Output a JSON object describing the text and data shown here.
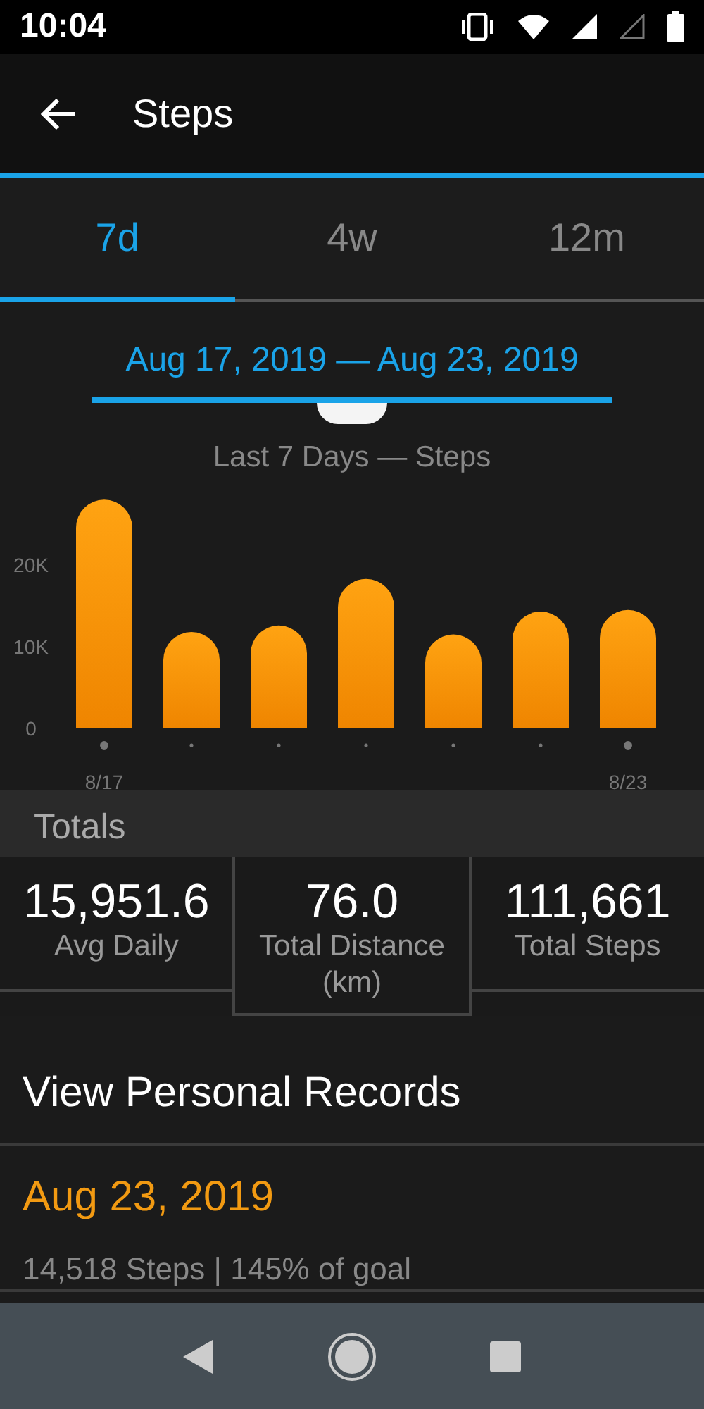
{
  "status_bar": {
    "time": "10:04"
  },
  "app_bar": {
    "title": "Steps"
  },
  "tabs": [
    {
      "label": "7d",
      "selected": true
    },
    {
      "label": "4w",
      "selected": false
    },
    {
      "label": "12m",
      "selected": false
    }
  ],
  "date_range": "Aug 17, 2019 — Aug 23, 2019",
  "chart": {
    "chart_data": {
      "type": "bar",
      "title": "Last 7 Days — Steps",
      "ylim": [
        0,
        28000
      ],
      "values": [
        28000,
        11800,
        12600,
        18300,
        11500,
        14300,
        14500
      ],
      "yticks": [
        {
          "value": 0,
          "label": "0"
        },
        {
          "value": 10000,
          "label": "10K"
        },
        {
          "value": 20000,
          "label": "20K"
        }
      ],
      "categories": [
        "8/17",
        null,
        null,
        null,
        null,
        null,
        "8/23"
      ]
    }
  },
  "totals": {
    "heading": "Totals",
    "stats": [
      {
        "value": "15,951.6",
        "label": "Avg Daily"
      },
      {
        "value": "76.0",
        "label": "Total Distance (km)"
      },
      {
        "value": "111,661",
        "label": "Total Steps"
      }
    ]
  },
  "records_link": "View Personal Records",
  "day_entries": [
    {
      "date": "Aug 23, 2019",
      "summary": "14,518 Steps | 145% of goal"
    }
  ]
}
